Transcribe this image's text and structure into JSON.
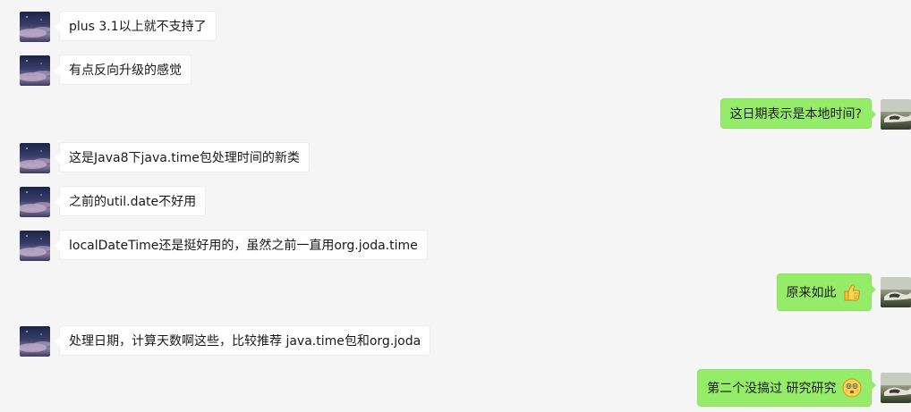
{
  "messages": [
    {
      "side": "left",
      "text": "plus 3.1以上就不支持了"
    },
    {
      "side": "left",
      "text": "有点反向升级的感觉"
    },
    {
      "side": "right",
      "text": "这日期表示是本地时间?"
    },
    {
      "side": "left",
      "text": "这是Java8下java.time包处理时间的新类"
    },
    {
      "side": "left",
      "text": "之前的util.date不好用"
    },
    {
      "side": "left",
      "text": "localDateTime还是挺好用的，虽然之前一直用org.joda.time"
    },
    {
      "side": "right",
      "text": "原来如此",
      "emoji": "thumbs-up-emoji"
    },
    {
      "side": "left",
      "text": "处理日期，计算天数啊这些，比较推荐 java.time包和org.joda"
    },
    {
      "side": "right",
      "text": "第二个没搞过  研究研究",
      "emoji": "dizzy-face-emoji"
    }
  ],
  "colors": {
    "background": "#f5f5f5",
    "left_bubble": "#ffffff",
    "right_bubble": "#95ec69"
  }
}
